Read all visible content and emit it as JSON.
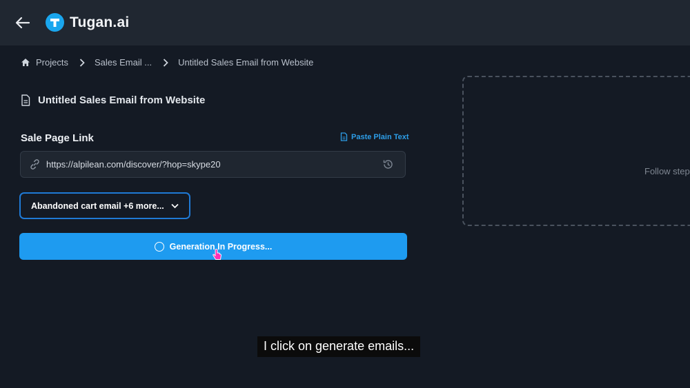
{
  "app": {
    "name": "Tugan.ai"
  },
  "breadcrumb": {
    "items": [
      "Projects",
      "Sales Email ...",
      "Untitled Sales Email from Website"
    ]
  },
  "document": {
    "title": "Untitled Sales Email from Website"
  },
  "form": {
    "link_label": "Sale Page Link",
    "paste_label": "Paste Plain Text",
    "url_value": "https://alpilean.com/discover/?hop=skype20",
    "email_types_label": "Abandoned cart email +6 more...",
    "generate_label": "Generation In Progress..."
  },
  "preview": {
    "placeholder": "Follow steps"
  },
  "caption": {
    "text": "I click on generate emails..."
  },
  "colors": {
    "accent": "#1e9bf0",
    "logo": "#1aa6ee",
    "link": "#2d9ee8",
    "cursor": "#ff2fb5"
  }
}
